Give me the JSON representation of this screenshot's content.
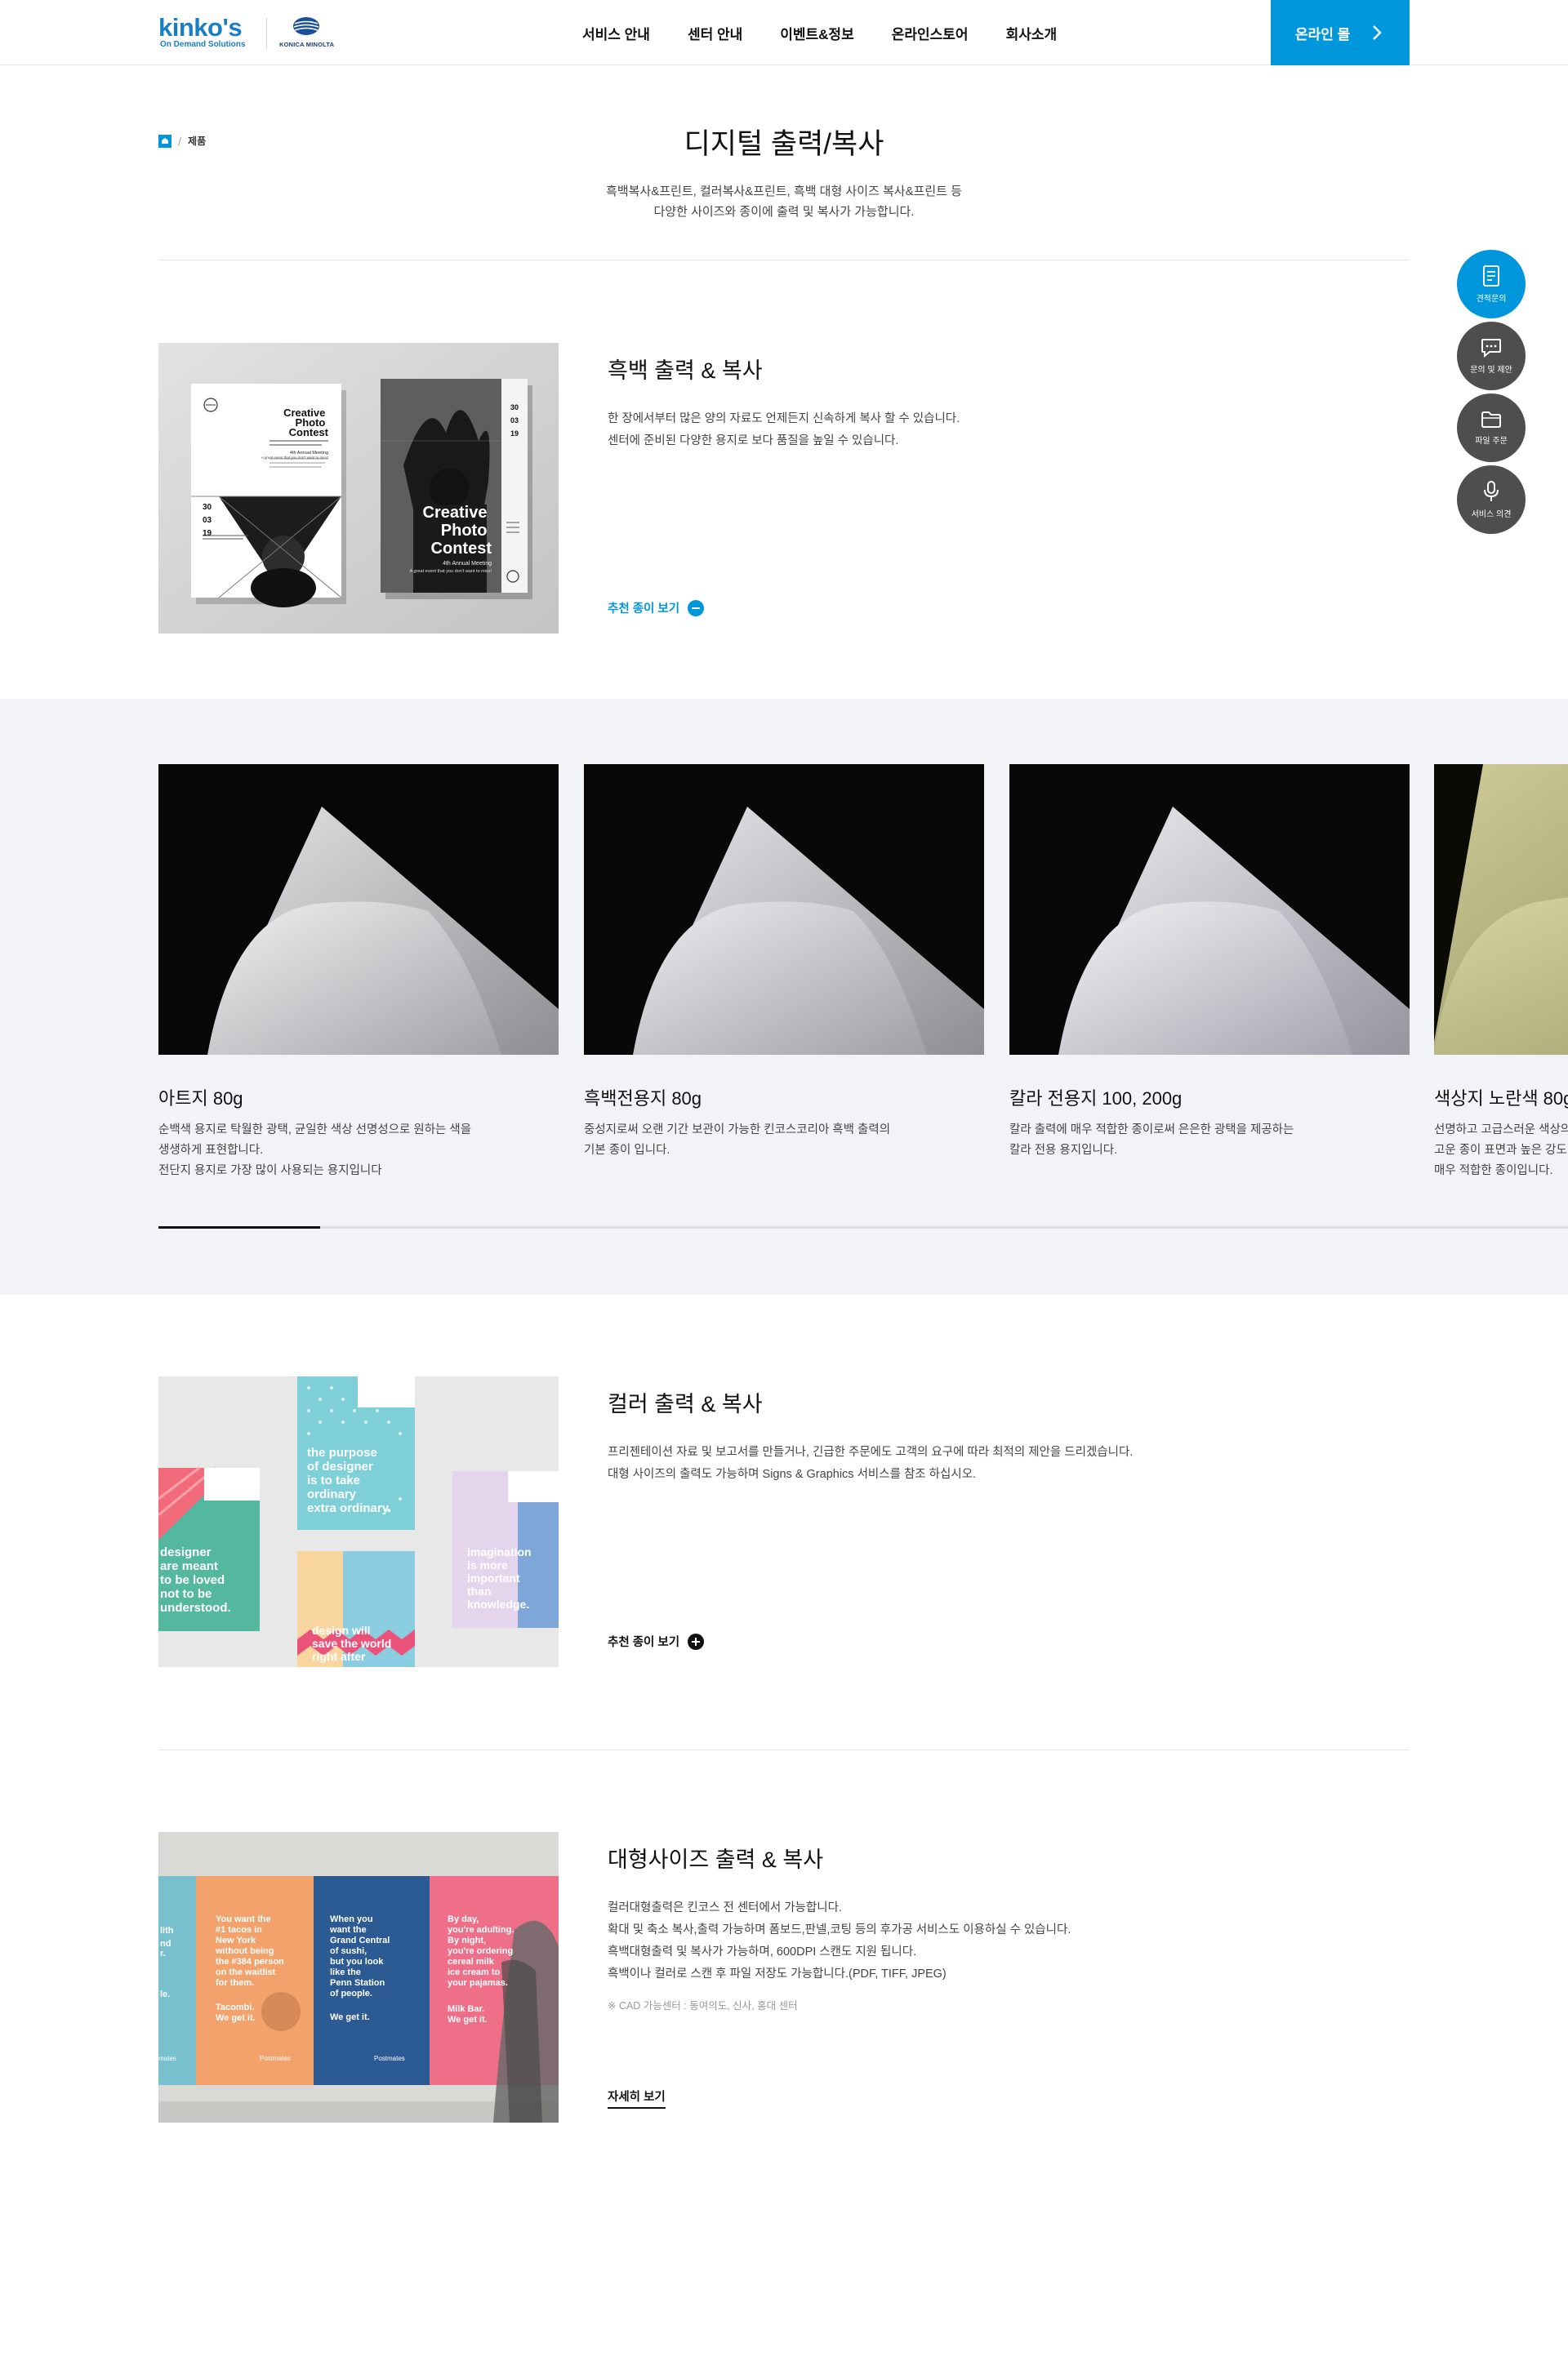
{
  "header": {
    "logo_text": "kinko's",
    "logo_sub": "On Demand Solutions",
    "partner_text": "KONICA MINOLTA",
    "nav": [
      "서비스 안내",
      "센터 안내",
      "이벤트&정보",
      "온라인스토어",
      "회사소개"
    ],
    "online_button": "온라인 몰"
  },
  "breadcrumb": {
    "current": "제품"
  },
  "page": {
    "title": "디지털 출력/복사",
    "desc_line1": "흑백복사&프린트, 컬러복사&프린트, 흑백 대형 사이즈 복사&프린트 등",
    "desc_line2": "다양한 사이즈와 종이에 출력 및 복사가 가능합니다."
  },
  "sections": {
    "mono": {
      "title": "흑백 출력 & 복사",
      "desc_line1": "한 장에서부터 많은 양의 자료도 언제든지 신속하게 복사 할 수 있습니다.",
      "desc_line2": "센터에 준비된 다양한 용지로 보다 품질을 높일 수 있습니다.",
      "link": "추천 종이 보기",
      "poster_title": "Creative Photo Contest",
      "poster_sub": "4th Annual Meeting",
      "poster_tagline": "A great event that you don't want to miss!",
      "poster_dates": [
        "30",
        "03",
        "19"
      ]
    },
    "color": {
      "title": "컬러 출력 & 복사",
      "desc_line1": "프리젠테이션 자료 및 보고서를 만들거나, 긴급한 주문에도 고객의 요구에 따라 최적의 제안을 드리겠습니다.",
      "desc_line2": "대형 사이즈의 출력도 가능하며 Signs & Graphics 서비스를 참조 하십시오.",
      "link": "추천 종이 보기",
      "poster_texts": [
        "the purpose of designer is to take ordinary extra ordinary.",
        "designer are meant to be loved not to be understood.",
        "imagination is more important than knowledge.",
        "design will save the world right after"
      ]
    },
    "large": {
      "title": "대형사이즈 출력 & 복사",
      "desc_line1": "컬러대형출력은 킨코스 전 센터에서 가능합니다.",
      "desc_line2": "확대 및 축소 복사,출력 가능하며 폼보드,판넬,코팅 등의 후가공 서비스도 이용하실 수 있습니다.",
      "desc_line3": "흑백대형출력 및 복사가 가능하며, 600DPI 스캔도 지원 됩니다.",
      "desc_line4": "흑백이나 컬러로 스캔 후 파일 저장도 가능합니다.(PDF, TIFF, JPEG)",
      "note": "※ CAD 가능센터 : 동여의도, 신사, 홍대 센터",
      "link": "자세히 보기",
      "poster_texts": [
        "You want the #1 tacos in New York without being the #384 person on the waitlist for them.",
        "Tacombi. We get it.",
        "When you want the Grand Central of sushi, but you look like the Penn Station of people.",
        "We get it.",
        "By day, you're adulting. By night, you're ordering cereal milk ice cream to your pajamas.",
        "Milk Bar. We get it.",
        "Postmates",
        "Postmates"
      ]
    }
  },
  "papers": [
    {
      "name": "아트지 80g",
      "desc_line1": "순백색 용지로 탁월한 광택, 균일한 색상 선명성으로 원하는 색을",
      "desc_line2": "생생하게 표현합니다.",
      "desc_line3": "전단지 용지로 가장 많이 사용되는 용지입니다",
      "color": "#c9c9cb"
    },
    {
      "name": "흑백전용지 80g",
      "desc_line1": "중성지로써 오랜 기간 보관이 가능한 킨코스코리아 흑백 출력의",
      "desc_line2": "기본 종이 입니다.",
      "desc_line3": "",
      "color": "#c6c6c9"
    },
    {
      "name": "칼라 전용지 100, 200g",
      "desc_line1": "칼라 출력에 매우 적합한 종이로써 은은한 광택을 제공하는",
      "desc_line2": "칼라 전용 용지입니다.",
      "desc_line3": "",
      "color": "#cacace"
    },
    {
      "name": "색상지 노란색 80g",
      "desc_line1": "선명하고 고급스러운 색상의",
      "desc_line2": "고운 종이 표면과 높은 강도",
      "desc_line3": "매우 적합한 종이입니다.",
      "color": "#b8b583"
    }
  ],
  "slider": {
    "progress": 0.25
  },
  "quick_menu": [
    "견적문의",
    "문의 및 제안",
    "파일 주문",
    "서비스 의견"
  ],
  "colors": {
    "accent": "#0096dc",
    "band_bg": "#f2f3f6",
    "quick_bg": "#4e4e4e"
  }
}
